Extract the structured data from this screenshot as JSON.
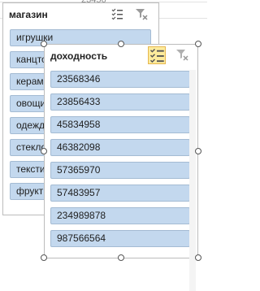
{
  "background": {
    "top_fragment": "23456"
  },
  "back_slicer": {
    "title": "магазин",
    "items": [
      {
        "label": "игрушки"
      },
      {
        "label": "канцтовары"
      },
      {
        "label": "керамика"
      },
      {
        "label": "овощи"
      },
      {
        "label": "одежда"
      },
      {
        "label": "стекло"
      },
      {
        "label": "текстиль"
      },
      {
        "label": "фрукты"
      }
    ],
    "icons": {
      "multiselect": "multi-select-icon",
      "clear": "clear-filter-icon"
    }
  },
  "front_slicer": {
    "title": "доходность",
    "items": [
      {
        "label": "23568346"
      },
      {
        "label": "23856433"
      },
      {
        "label": "45834958"
      },
      {
        "label": "46382098"
      },
      {
        "label": "57365970"
      },
      {
        "label": "57483957"
      },
      {
        "label": "234989878"
      },
      {
        "label": "987566564"
      }
    ],
    "icons": {
      "multiselect": "multi-select-icon",
      "clear": "clear-filter-icon"
    },
    "multiselect_active": true
  },
  "colors": {
    "item_fill": "#c3d8ee",
    "item_border": "#a4bbd3",
    "active_icon_bg": "#fdeb9c"
  }
}
